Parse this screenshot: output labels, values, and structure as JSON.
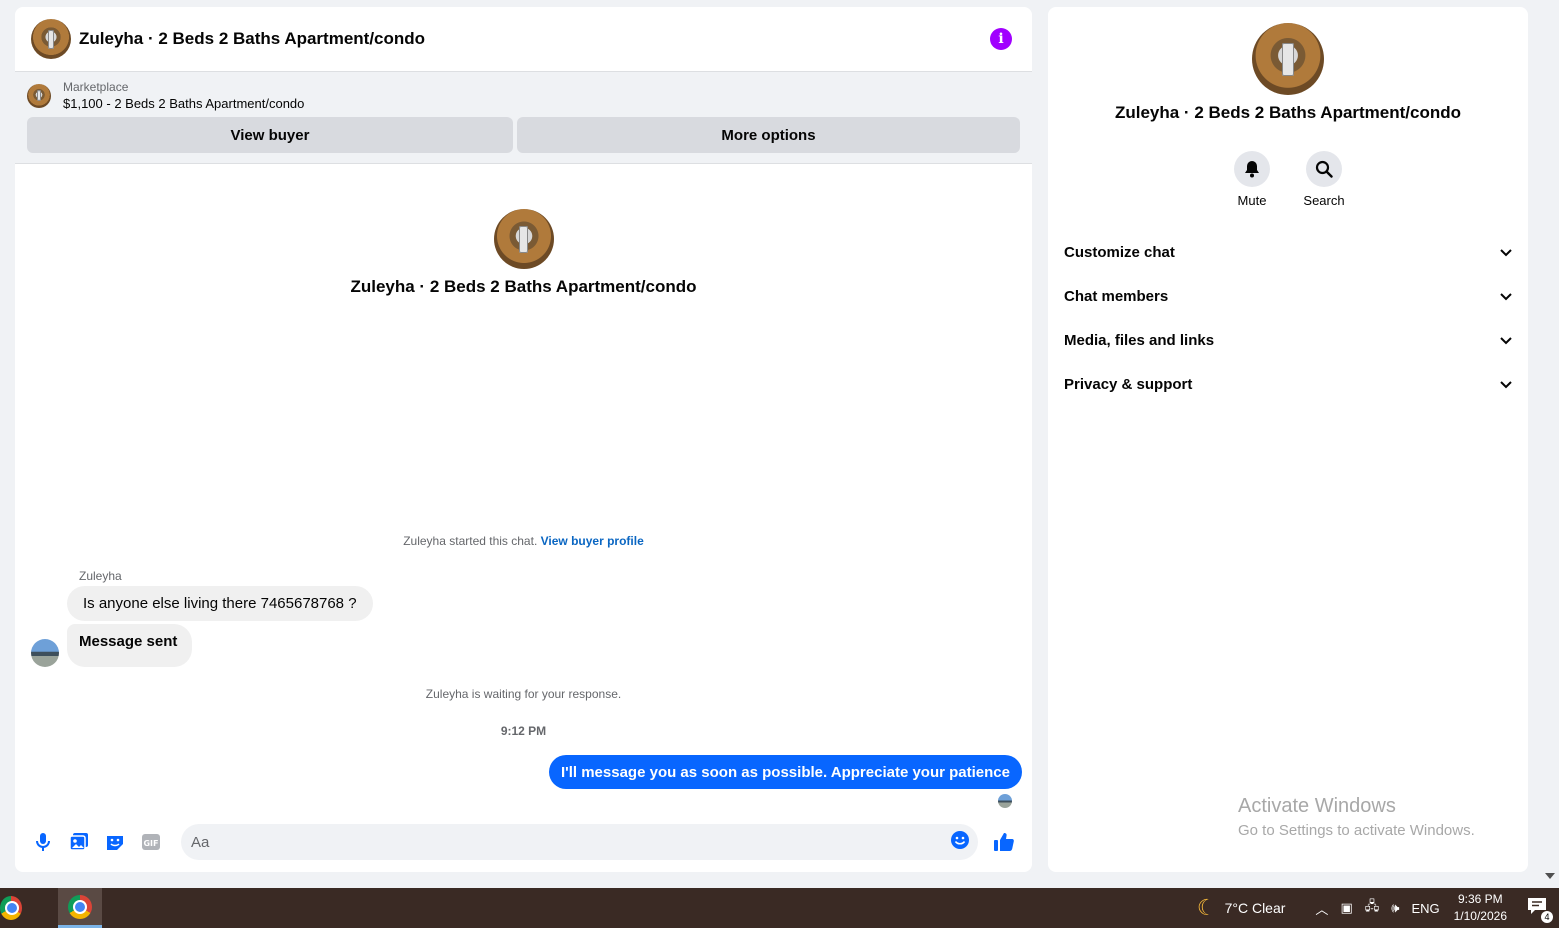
{
  "chat": {
    "title": "Zuleyha · 2 Beds 2 Baths Apartment/condo",
    "marketplace_label": "Marketplace",
    "listing": "$1,100 - 2 Beds 2 Baths Apartment/condo",
    "view_buyer": "View buyer",
    "more_options": "More options",
    "profile_name": "Zuleyha · 2 Beds 2 Baths Apartment/condo",
    "started_text": "Zuleyha started this chat.",
    "view_buyer_profile": "View buyer profile",
    "sender_name": "Zuleyha",
    "messages": [
      {
        "text": "Is anyone else living there 7465678768 ?",
        "direction": "incoming"
      },
      {
        "text": "Message sent",
        "direction": "incoming"
      }
    ],
    "waiting_text": "Zuleyha is waiting for your response.",
    "time": "9:12 PM",
    "outgoing_message": "I'll message you as soon as possible. Appreciate your patience",
    "composer_placeholder": "Aa",
    "accent_color": "#0866ff",
    "info_color": "#a100ff"
  },
  "details": {
    "name": "Zuleyha · 2 Beds 2 Baths Apartment/condo",
    "mute": "Mute",
    "search": "Search",
    "sections": [
      "Customize chat",
      "Chat members",
      "Media, files and links",
      "Privacy & support"
    ],
    "activate_title": "Activate Windows",
    "activate_subtitle": "Go to Settings to activate Windows."
  },
  "taskbar": {
    "weather": "7°C  Clear",
    "language": "ENG",
    "time": "9:36 PM",
    "date": "1/10/2026",
    "notifications": "4"
  }
}
